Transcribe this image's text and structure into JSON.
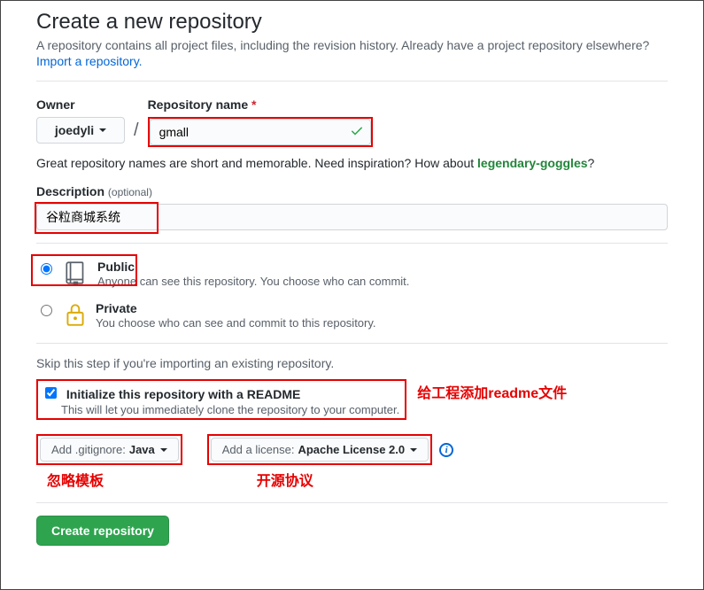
{
  "header": {
    "title": "Create a new repository",
    "subtitle": "A repository contains all project files, including the revision history. Already have a project repository elsewhere?",
    "import_link": "Import a repository"
  },
  "owner": {
    "label": "Owner",
    "selected": "joedyli"
  },
  "repo_name": {
    "label": "Repository name",
    "value": "gmall"
  },
  "name_hint": {
    "prefix": "Great repository names are short and memorable. Need inspiration? How about ",
    "suggestion": "legendary-goggles",
    "suffix": "?"
  },
  "description": {
    "label": "Description",
    "optional": "(optional)",
    "value": "谷粒商城系统"
  },
  "visibility": {
    "public": {
      "title": "Public",
      "desc": "Anyone can see this repository. You choose who can commit."
    },
    "private": {
      "title": "Private",
      "desc": "You choose who can see and commit to this repository."
    }
  },
  "init": {
    "skip_hint": "Skip this step if you're importing an existing repository.",
    "readme_label": "Initialize this repository with a README",
    "readme_desc": "This will let you immediately clone the repository to your computer."
  },
  "dropdowns": {
    "gitignore_prefix": "Add .gitignore: ",
    "gitignore_value": "Java",
    "license_prefix": "Add a license: ",
    "license_value": "Apache License 2.0"
  },
  "submit": {
    "label": "Create repository"
  },
  "annotations": {
    "readme": "给工程添加readme文件",
    "gitignore": "忽略模板",
    "license": "开源协议"
  }
}
